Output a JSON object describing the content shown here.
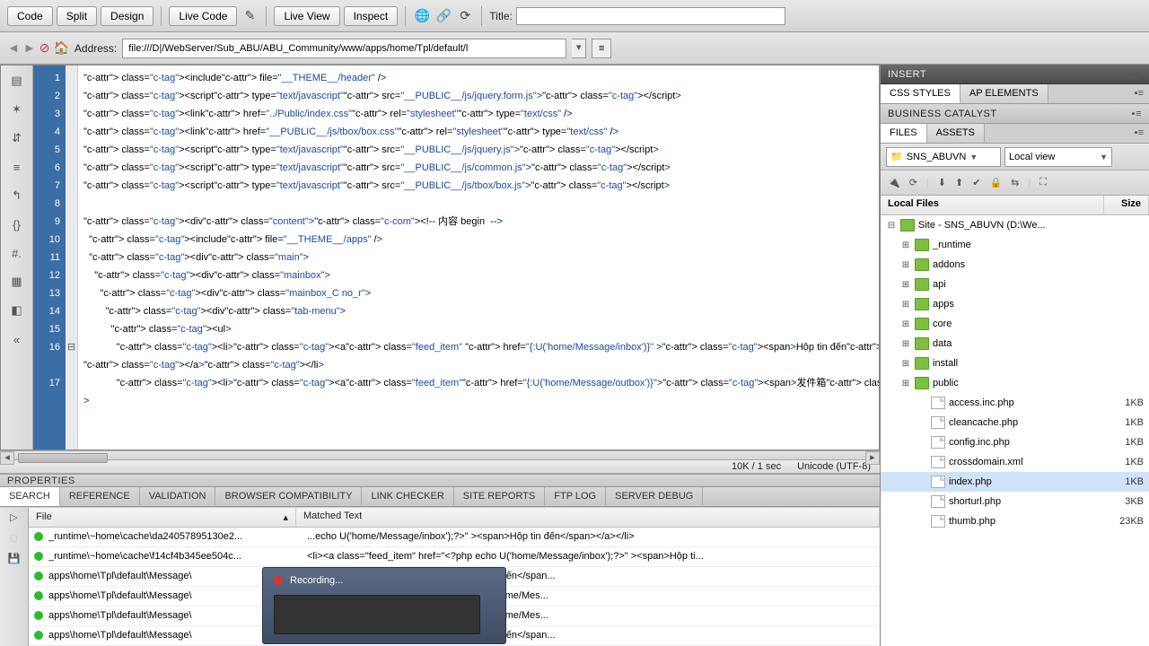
{
  "toolbar": {
    "code": "Code",
    "split": "Split",
    "design": "Design",
    "livecode": "Live Code",
    "liveview": "Live View",
    "inspect": "Inspect",
    "title_label": "Title:",
    "title_value": ""
  },
  "addressbar": {
    "label": "Address:",
    "value": "file:///D|/WebServer/Sub_ABU/ABU_Community/www/apps/home/Tpl/default/l"
  },
  "code_lines": [
    "<include file=\"__THEME__/header\" />",
    "<script type=\"text/javascript\" src=\"__PUBLIC__/js/jquery.form.js\"></script>",
    "<link href=\"../Public/index.css\" rel=\"stylesheet\" type=\"text/css\" />",
    "<link href=\"__PUBLIC__/js/tbox/box.css\" rel=\"stylesheet\" type=\"text/css\" />",
    "<script type=\"text/javascript\" src=\"__PUBLIC__/js/jquery.js\"></script>",
    "<script type=\"text/javascript\" src=\"__PUBLIC__/js/common.js\"></script>",
    "<script type=\"text/javascript\" src=\"__PUBLIC__/js/tbox/box.js\"></script>",
    "",
    "<div class=\"content\"><!-- 内容 begin  -->",
    "  <include file=\"__THEME__/apps\" />",
    "  <div class=\"main\">",
    "    <div class=\"mainbox\">",
    "      <div class=\"mainbox_C no_r\">",
    "        <div class=\"tab-menu\">",
    "          <ul>",
    "            <li><a class=\"feed_item\"  href=\"{:U('home/Message/inbox')}\" ><span>Hộp tin đến</span></a></li>",
    "            <li><a class=\"feed_item\" href=\"{:U('home/Message/outbox')}\"><span>发件箱</span></a></li>"
  ],
  "status": {
    "size": "10K / 1 sec",
    "encoding": "Unicode (UTF-8)"
  },
  "panels": {
    "properties": "PROPERTIES",
    "insert": "INSERT",
    "css_styles": "CSS STYLES",
    "ap_elements": "AP ELEMENTS",
    "business_catalyst": "BUSINESS CATALYST",
    "files": "FILES",
    "assets": "ASSETS"
  },
  "bottom_tabs": [
    "SEARCH",
    "REFERENCE",
    "VALIDATION",
    "BROWSER COMPATIBILITY",
    "LINK CHECKER",
    "SITE REPORTS",
    "FTP LOG",
    "SERVER DEBUG"
  ],
  "results": {
    "headers": {
      "file": "File",
      "matched": "Matched Text"
    },
    "rows": [
      {
        "file": "_runtime\\~home\\cache\\da24057895130e2...",
        "mt": "...echo U('home/Message/inbox');?>\" ><span>Hộp tin đến</span></a></li>"
      },
      {
        "file": "_runtime\\~home\\cache\\f14cf4b345ee504c...",
        "mt": "    <li><a class=\"feed_item\" href=\"<?php echo U('home/Message/inbox');?>\" ><span>Hộp ti..."
      },
      {
        "file": "apps\\home\\Tpl\\default\\Message\\",
        "mt": "U('home/Message/inbox')}\" ><span>Hộp tin đến</span..."
      },
      {
        "file": "apps\\home\\Tpl\\default\\Message\\",
        "mt": "=\"type\" value=\"inbox\">on</eq>\" href=\"{:U('home/Mes..."
      },
      {
        "file": "apps\\home\\Tpl\\default\\Message\\",
        "mt": "=\"type\" value=\"inbox\">on</eq>\" href=\"{:U('home/Mes..."
      },
      {
        "file": "apps\\home\\Tpl\\default\\Message\\",
        "mt": "U('home/Message/inbox')}\" ><span>Hộp tin đến</span..."
      }
    ]
  },
  "files_panel": {
    "site_dd": "SNS_ABUVN",
    "view_dd": "Local view",
    "header_name": "Local Files",
    "header_size": "Size",
    "root": "Site - SNS_ABUVN (D:\\We...",
    "folders": [
      "_runtime",
      "addons",
      "api",
      "apps",
      "core",
      "data",
      "install",
      "public"
    ],
    "files": [
      {
        "name": "access.inc.php",
        "size": "1KB"
      },
      {
        "name": "cleancache.php",
        "size": "1KB"
      },
      {
        "name": "config.inc.php",
        "size": "1KB"
      },
      {
        "name": "crossdomain.xml",
        "size": "1KB"
      },
      {
        "name": "index.php",
        "size": "1KB"
      },
      {
        "name": "shorturl.php",
        "size": "3KB"
      },
      {
        "name": "thumb.php",
        "size": "23KB"
      }
    ]
  },
  "recording": {
    "label": "Recording..."
  }
}
